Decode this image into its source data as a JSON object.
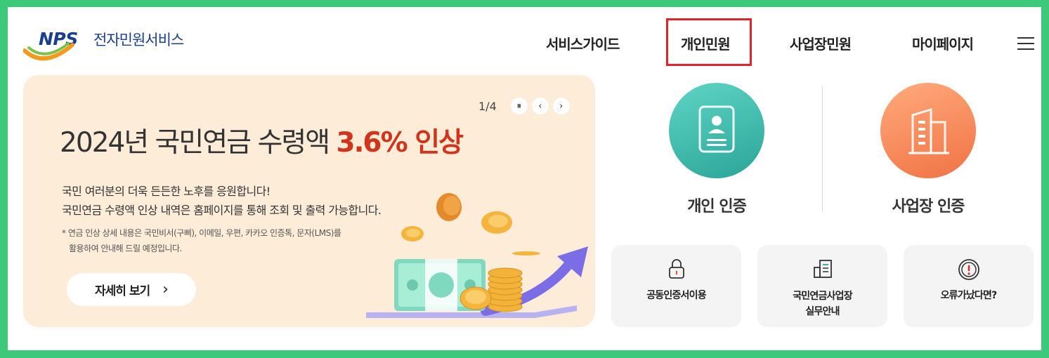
{
  "header": {
    "logo_mark": "NPS",
    "logo_text": "전자민원서비스",
    "nav": [
      {
        "label": "서비스가이드"
      },
      {
        "label": "개인민원"
      },
      {
        "label": "사업장민원"
      },
      {
        "label": "마이페이지"
      }
    ],
    "highlight_color": "#e0242c"
  },
  "banner": {
    "title_main": "2024년 국민연금 수령액 ",
    "title_highlight": "3.6% 인상",
    "desc_line1": "국민 여러분의 더욱 든든한 노후를 응원합니다!",
    "desc_line2": "국민연금 수령액 인상 내역은 홈페이지를 통해 조회 및 출력 가능합니다.",
    "note_line1": "* 연금 인상 상세 내용은 국민비서(구삐), 이메일, 우편, 카카오 인증톡, 문자(LMS)를",
    "note_line2": "활용하여 안내해 드릴 예정입니다.",
    "detail_button": "자세히 보기",
    "detail_arrow": "›",
    "pager_count": "1/4",
    "pause_icon": "⏸",
    "prev_icon": "‹",
    "next_icon": "›",
    "accent_color": "#d0351c"
  },
  "cert": {
    "personal_label": "개인 인증",
    "business_label": "사업장 인증"
  },
  "quick": [
    {
      "line1": "공동인증서이용",
      "line2": "",
      "icon": "lock-icon"
    },
    {
      "line1": "국민연금사업장",
      "line2": "실무안내",
      "icon": "building-document-icon"
    },
    {
      "line1": "오류가났다면?",
      "line2": "",
      "icon": "warning-icon"
    }
  ]
}
